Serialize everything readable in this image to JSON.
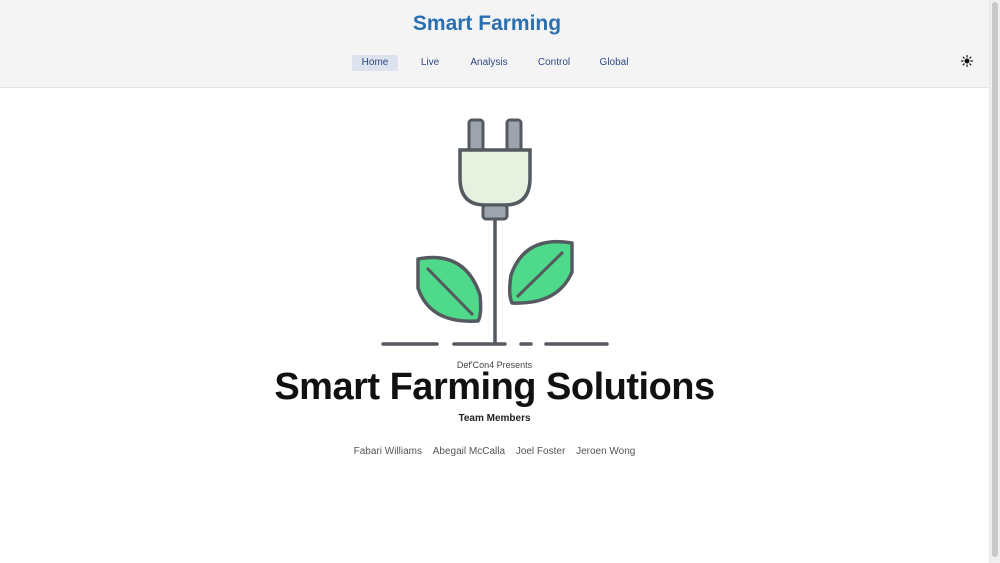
{
  "header": {
    "title": "Smart Farming",
    "nav": [
      {
        "label": "Home",
        "active": true
      },
      {
        "label": "Live",
        "active": false
      },
      {
        "label": "Analysis",
        "active": false
      },
      {
        "label": "Control",
        "active": false
      },
      {
        "label": "Global",
        "active": false
      }
    ],
    "theme_icon": "sun-icon"
  },
  "hero": {
    "illustration_icon": "plug-plant-icon",
    "presents": "Def'Con4 Presents",
    "title": "Smart Farming Solutions",
    "team_heading": "Team Members",
    "members": [
      "Fabari Williams",
      "Abegail McCalla",
      "Joel Foster",
      "Jeroen Wong"
    ]
  },
  "colors": {
    "brand": "#2a6fb0",
    "leaf": "#4fd98a",
    "plug": "#e6f1e0",
    "outline": "#555a60"
  }
}
